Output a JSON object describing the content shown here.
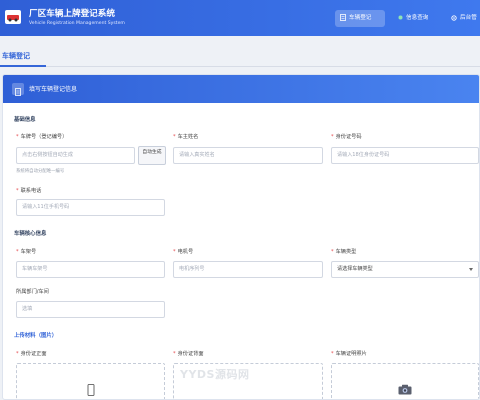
{
  "header": {
    "title": "厂区车辆上牌登记系统",
    "subtitle": "Vehicle Registration Management System",
    "nav": [
      {
        "label": "车辆登记",
        "icon": "document-icon",
        "active": true
      },
      {
        "label": "信息查询",
        "icon": "dot-icon",
        "active": false
      },
      {
        "label": "后台管",
        "icon": "gear-icon",
        "active": false
      }
    ],
    "accent": "#2f5fd6"
  },
  "page": {
    "title": "车辆登记"
  },
  "card": {
    "title": "填写车辆登记信息"
  },
  "sections": {
    "basic": "基础信息",
    "core": "车辆核心信息",
    "upload": "上传材料（图片）"
  },
  "fields": {
    "plate": {
      "label": "车牌号（登记编号）",
      "placeholder": "点击右侧按钮自动生成",
      "hint": "系统将自动分配唯一编号",
      "required": true
    },
    "auto_button": "自动生成",
    "owner": {
      "label": "车主姓名",
      "placeholder": "请输入真实姓名",
      "required": true
    },
    "idcard": {
      "label": "身份证号码",
      "placeholder": "请输入18位身份证号码",
      "required": true
    },
    "phone": {
      "label": "联系电话",
      "placeholder": "请输入11位手机号码",
      "required": true
    },
    "frame": {
      "label": "车架号",
      "placeholder": "车辆车架号",
      "required": true
    },
    "motor": {
      "label": "电机号",
      "placeholder": "电机序列号",
      "required": true
    },
    "type": {
      "label": "车辆类型",
      "value": "请选择车辆类型",
      "required": true
    },
    "dept": {
      "label": "所属部门/车间",
      "placeholder": "选填",
      "required": false
    }
  },
  "uploads": [
    {
      "label": "身份证正面",
      "icon": "phone-icon",
      "required": true
    },
    {
      "label": "身份证背面",
      "icon": "none",
      "required": true
    },
    {
      "label": "车辆证明照片",
      "icon": "camera-icon",
      "required": true
    }
  ],
  "watermark": "YYDS源码网"
}
